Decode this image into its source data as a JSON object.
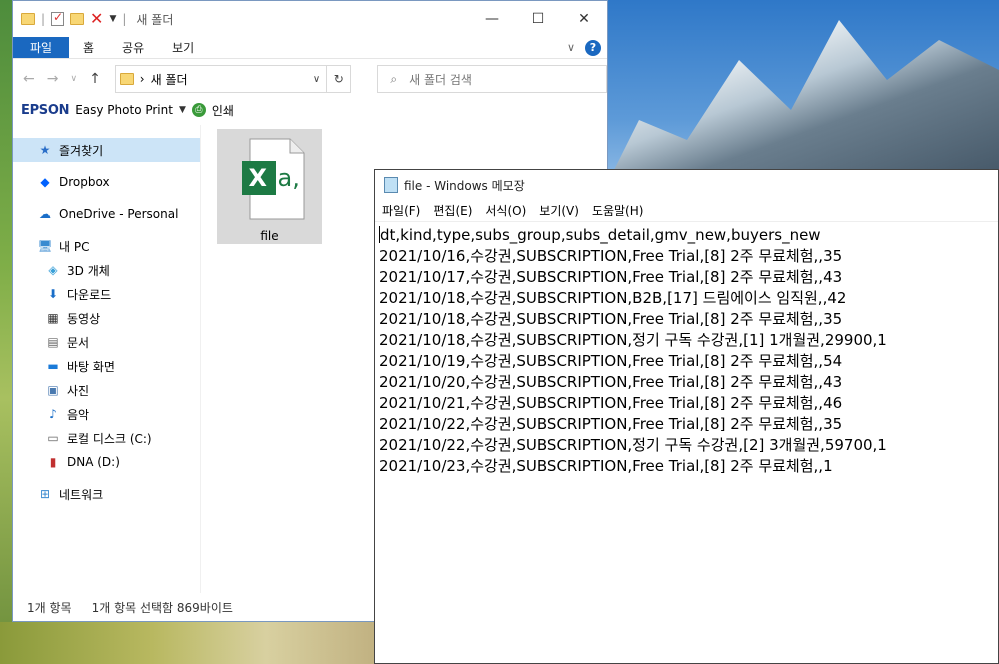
{
  "explorer": {
    "title": "새 폴더",
    "window_controls": {
      "minimize": "—",
      "maximize": "☐",
      "close": "✕"
    },
    "ribbon_tabs": [
      "파일",
      "홈",
      "공유",
      "보기"
    ],
    "help": "?",
    "address": "새 폴더",
    "search_placeholder": "새 폴더 검색",
    "epson": {
      "logo": "EPSON",
      "app": "Easy Photo Print",
      "print": "인쇄"
    },
    "nav": {
      "favorites": "즐겨찾기",
      "dropbox": "Dropbox",
      "onedrive": "OneDrive - Personal",
      "pc": "내 PC",
      "objects3d": "3D 개체",
      "downloads": "다운로드",
      "videos": "동영상",
      "documents": "문서",
      "desktop": "바탕 화면",
      "pictures": "사진",
      "music": "음악",
      "local_disk": "로컬 디스크 (C:)",
      "dna": "DNA (D:)",
      "network": "네트워크"
    },
    "file": {
      "name": "file",
      "icon_letter": "X",
      "icon_text": "a,"
    },
    "status": {
      "count": "1개 항목",
      "selected": "1개 항목 선택함 869바이트"
    }
  },
  "notepad": {
    "title": "file - Windows 메모장",
    "menu": [
      "파일(F)",
      "편집(E)",
      "서식(O)",
      "보기(V)",
      "도움말(H)"
    ],
    "lines": [
      "dt,kind,type,subs_group,subs_detail,gmv_new,buyers_new",
      "2021/10/16,수강권,SUBSCRIPTION,Free Trial,[8] 2주 무료체험,,35",
      "2021/10/17,수강권,SUBSCRIPTION,Free Trial,[8] 2주 무료체험,,43",
      "2021/10/18,수강권,SUBSCRIPTION,B2B,[17] 드림에이스 임직원,,42",
      "2021/10/18,수강권,SUBSCRIPTION,Free Trial,[8] 2주 무료체험,,35",
      "2021/10/18,수강권,SUBSCRIPTION,정기 구독 수강권,[1] 1개월권,29900,1",
      "2021/10/19,수강권,SUBSCRIPTION,Free Trial,[8] 2주 무료체험,,54",
      "2021/10/20,수강권,SUBSCRIPTION,Free Trial,[8] 2주 무료체험,,43",
      "2021/10/21,수강권,SUBSCRIPTION,Free Trial,[8] 2주 무료체험,,46",
      "2021/10/22,수강권,SUBSCRIPTION,Free Trial,[8] 2주 무료체험,,35",
      "2021/10/22,수강권,SUBSCRIPTION,정기 구독 수강권,[2] 3개월권,59700,1",
      "2021/10/23,수강권,SUBSCRIPTION,Free Trial,[8] 2주 무료체험,,1"
    ]
  },
  "colors": {
    "accent": "#1a68c0",
    "selection": "#cce4f7",
    "excel_green": "#1d7a44"
  }
}
